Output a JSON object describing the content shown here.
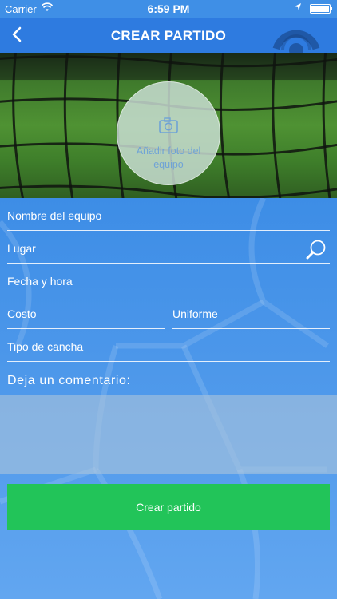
{
  "status_bar": {
    "carrier": "Carrier",
    "time": "6:59 PM"
  },
  "nav": {
    "title": "CREAR PARTIDO"
  },
  "photo": {
    "label": "Añadir foto del equipo"
  },
  "form": {
    "team_name_placeholder": "Nombre del equipo",
    "place_placeholder": "Lugar",
    "datetime_placeholder": "Fecha y hora",
    "cost_placeholder": "Costo",
    "uniform_placeholder": "Uniforme",
    "field_type_placeholder": "Tipo de cancha",
    "comment_label": "Deja un comentario:",
    "comment_value": "",
    "submit_label": "Crear partido"
  },
  "colors": {
    "primary": "#2e7be0",
    "background": "#3f8fe6",
    "submit": "#22c459"
  },
  "icons": [
    "back-chevron-icon",
    "app-logo-icon",
    "camera-icon",
    "search-icon",
    "wifi-icon",
    "location-icon",
    "battery-icon"
  ]
}
